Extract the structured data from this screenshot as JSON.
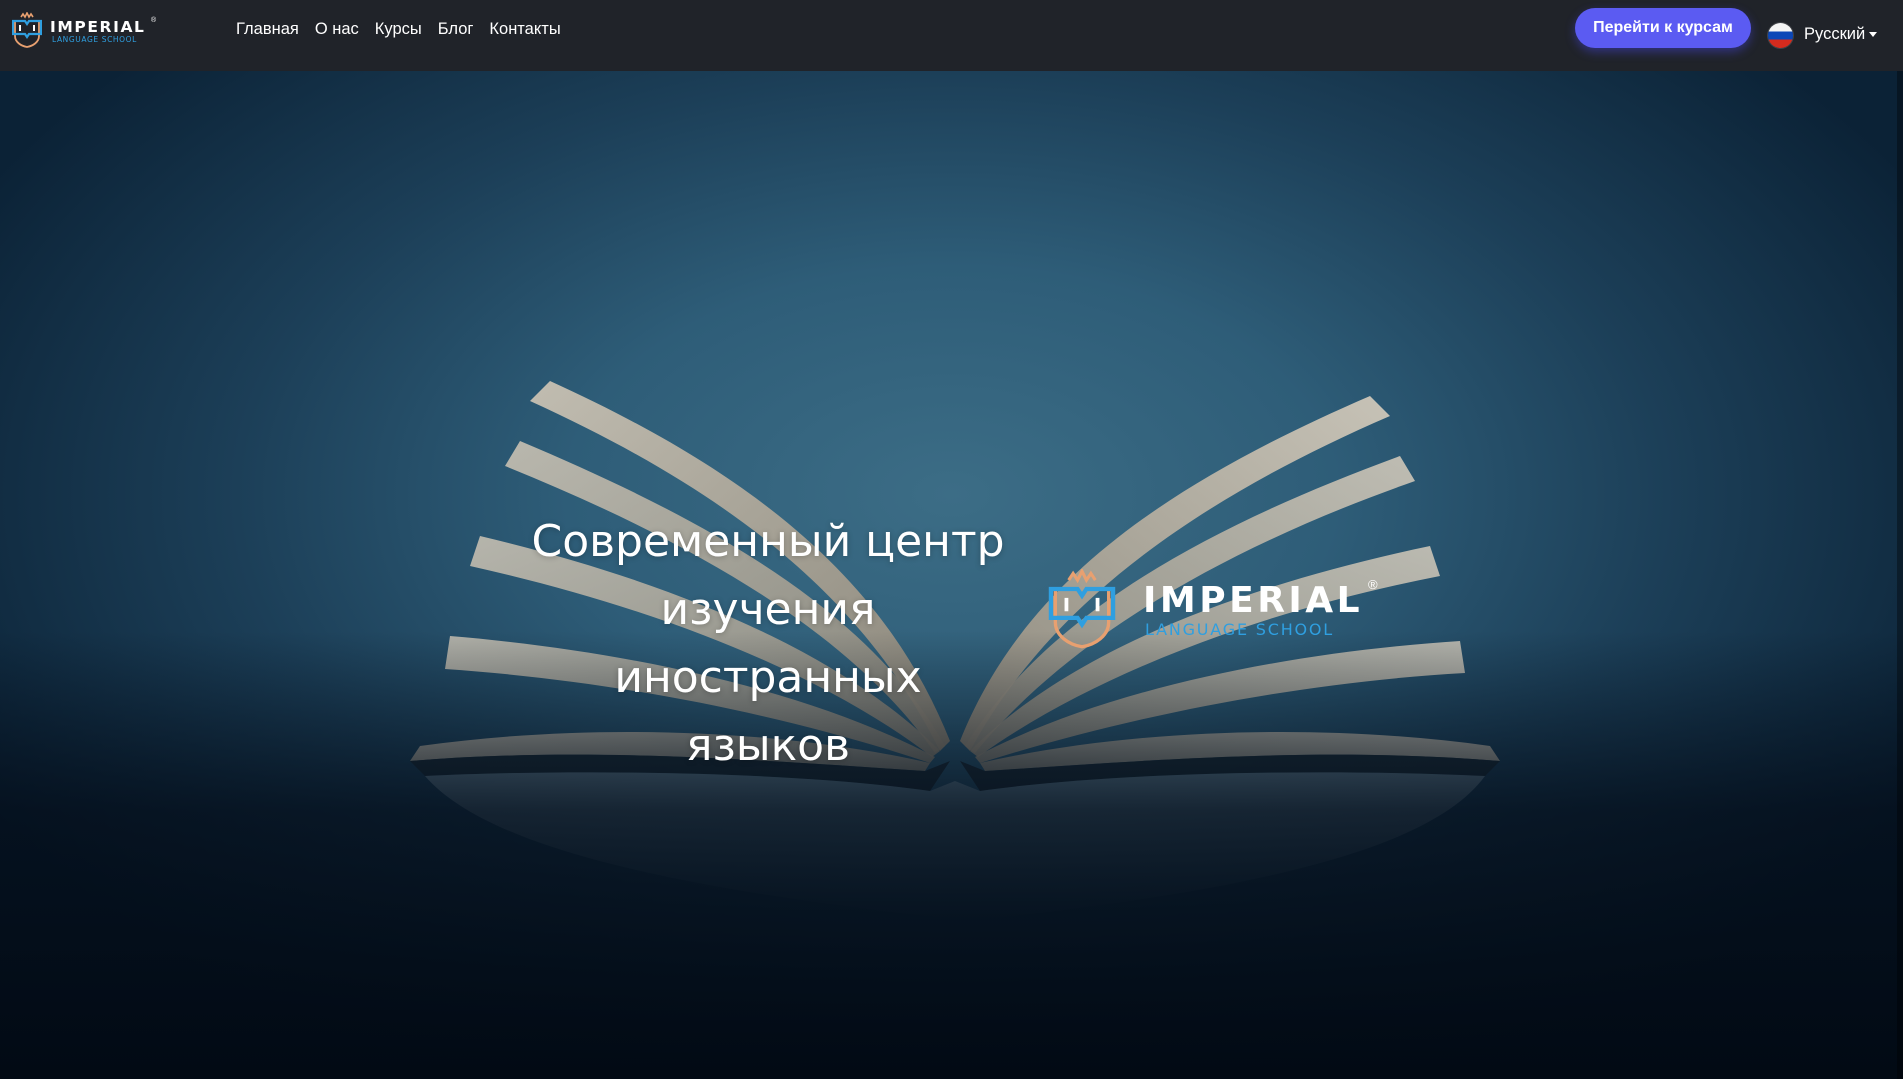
{
  "header": {
    "logo": {
      "name": "IMPERIAL",
      "reg": "®",
      "sub": "LANGUAGE SCHOOL"
    },
    "nav": [
      {
        "label": "Главная"
      },
      {
        "label": "О нас"
      },
      {
        "label": "Курсы"
      },
      {
        "label": "Блог"
      },
      {
        "label": "Контакты"
      }
    ],
    "cta_label": "Перейти к курсам",
    "language": {
      "label": "Русский",
      "flag_icon": "russia-flag-icon"
    }
  },
  "hero": {
    "headline_lines": [
      "Современный центр",
      "изучения иностранных",
      "языков"
    ],
    "logo": {
      "name": "IMPERIAL",
      "reg": "®",
      "sub": "LANGUAGE SCHOOL"
    },
    "background_image": "open-book-photo"
  },
  "colors": {
    "header_bg": "#202329",
    "accent": "#5b5bf2",
    "logo_blue": "#2f9fe0",
    "logo_orange": "#e8a070"
  }
}
